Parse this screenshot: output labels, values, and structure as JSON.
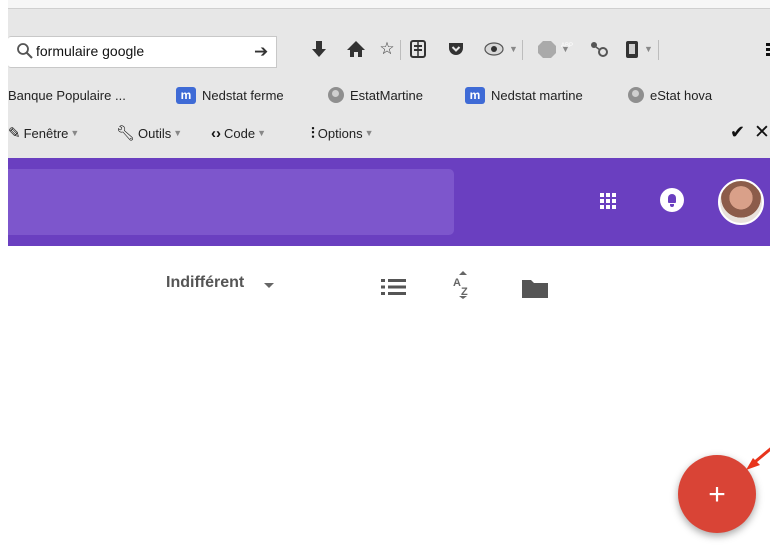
{
  "browser": {
    "url_value": "formulaire google",
    "bookmarks": [
      {
        "label": "Banque Populaire ...",
        "icon": "none"
      },
      {
        "label": "Nedstat ferme",
        "icon": "m-badge-icon"
      },
      {
        "label": "EstatMartine",
        "icon": "globe-icon"
      },
      {
        "label": "Nedstat martine",
        "icon": "m-badge-icon"
      },
      {
        "label": "eStat hova",
        "icon": "globe-icon"
      }
    ],
    "devbar": {
      "fenetre": "Fenêtre",
      "outils": "Outils",
      "code": "Code",
      "options": "Options"
    }
  },
  "toolbar": {
    "abp": "ABP"
  },
  "filter": {
    "owner_label": "Indifférent"
  },
  "fab": {
    "label": "+"
  },
  "colors": {
    "header_purple": "#6a3fc0",
    "search_purple": "#7d56cc",
    "fab_red": "#d94436",
    "annotation_arrow": "#e8341c"
  }
}
